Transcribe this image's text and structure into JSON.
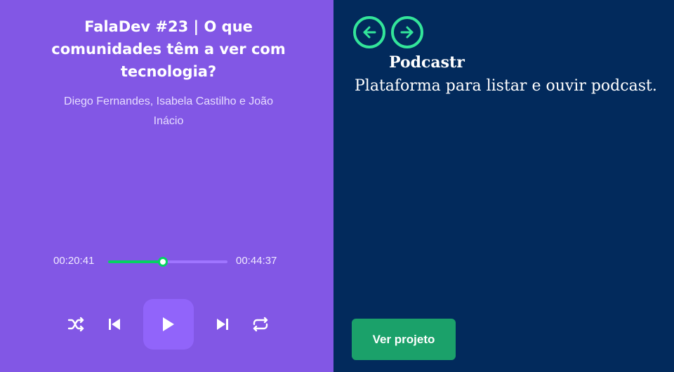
{
  "player": {
    "episode_title": "FalaDev #23 | O que comunidades têm a ver com tecnologia?",
    "members": "Diego Fernandes, Isabela Castilho e João Inácio",
    "current_time": "00:20:41",
    "total_time": "00:44:37",
    "progress": 0.46,
    "controls": [
      "shuffle-icon",
      "previous-icon",
      "play-icon",
      "next-icon",
      "repeat-icon"
    ]
  },
  "project": {
    "name": "Podcastr",
    "description": "Plataforma para listar e ouvir podcast.",
    "view_button_label": "Ver projeto",
    "nav": [
      "arrow-left-icon",
      "arrow-right-icon"
    ]
  },
  "colors": {
    "player_bg": "#8257e5",
    "play_button_bg": "#9164fa",
    "progress_green": "#04d361",
    "project_bg": "#022a5c",
    "nav_accent": "#33e59a",
    "view_button_bg": "#1ba16a"
  }
}
